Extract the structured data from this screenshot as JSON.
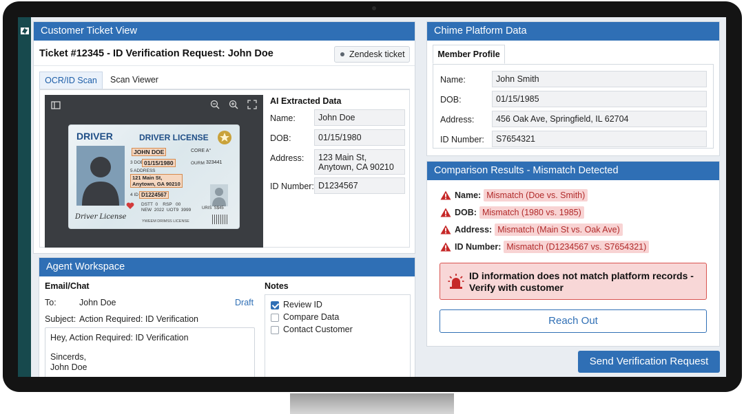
{
  "ticket_panel": {
    "title": "Customer Ticket View",
    "ticket_title": "Ticket #12345 - ID Verification Request: John Doe",
    "badge": "Zendesk ticket",
    "tabs": [
      {
        "label": "OCR/ID Scan"
      },
      {
        "label": "Scan Viewer"
      }
    ],
    "id_card": {
      "header_left": "DRIVER",
      "header_title": "DRIVER LICENSE",
      "name": "JOHN DOE",
      "class": "CORE A°",
      "dob_label": "3 DOB",
      "dob": "01/15/1980",
      "dd_label": "OURM",
      "dd": "323441",
      "address_label": "5 ADDRESS",
      "address_line1": "121 Main St,",
      "address_line2": "Anytown, GA 90210",
      "id_label": "4 ID",
      "id": "D1224567",
      "row1": "DSTT  0    RSP   00",
      "row2": "NEW  2022  UOT9  3999",
      "side_label": "URIS  S$45",
      "footer": "YWEEM DRIMSS LICENSE",
      "signature": "Driver License"
    },
    "ai": {
      "title": "AI Extracted Data",
      "fields": [
        {
          "label": "Name:",
          "value": "John Doe"
        },
        {
          "label": "DOB:",
          "value": "01/15/1980"
        },
        {
          "label": "Address:",
          "value": "123 Main St, Anytown, CA 90210"
        },
        {
          "label": "ID Number:",
          "value": "D1234567"
        }
      ]
    }
  },
  "workspace": {
    "title": "Agent Workspace",
    "email": {
      "heading": "Email/Chat",
      "to_label": "To:",
      "to_value": "John Doe",
      "draft": "Draft",
      "subject_label": "Subject:",
      "subject_value": "Action Required: ID Verification",
      "body_line1": "Hey, Action Required: ID Verification",
      "body_line2": "Sincerds,",
      "body_line3": "John Doe"
    },
    "notes": {
      "heading": "Notes",
      "items": [
        {
          "label": "Review ID",
          "checked": true
        },
        {
          "label": "Compare Data",
          "checked": false
        },
        {
          "label": "Contact Customer",
          "checked": false
        }
      ]
    }
  },
  "platform": {
    "title": "Chime Platform Data",
    "tab": "Member Profile",
    "fields": [
      {
        "label": "Name:",
        "value": "John Smith"
      },
      {
        "label": "DOB:",
        "value": "01/15/1985"
      },
      {
        "label": "Address:",
        "value": "456 Oak Ave, Springfield, IL 62704"
      },
      {
        "label": "ID Number:",
        "value": "S7654321"
      }
    ]
  },
  "comparison": {
    "title": "Comparison Results - Mismatch Detected",
    "rows": [
      {
        "label": "Name:",
        "value": "Mismatch (Doe vs. Smith)"
      },
      {
        "label": "DOB:",
        "value": "Mismatch (1980 vs. 1985)"
      },
      {
        "label": "Address:",
        "value": "Mismatch (Main St vs. Oak Ave)"
      },
      {
        "label": "ID Number:",
        "value": "Mismatch (D1234567 vs. S7654321)"
      }
    ],
    "alert_line1": "ID information does not match platform records -",
    "alert_line2": "Verify with customer",
    "reach_out": "Reach Out"
  },
  "send_button": "Send Verification Request",
  "colors": {
    "accent": "#2f6fb5",
    "danger": "#c0392b",
    "danger_bg": "#f8d7d7",
    "rail": "#17494d"
  },
  "icons": [
    "zendesk-logo-icon",
    "sidebar-toggle-icon",
    "zoom-out-icon",
    "zoom-in-icon",
    "fullscreen-icon",
    "warning-icon",
    "siren-icon"
  ]
}
